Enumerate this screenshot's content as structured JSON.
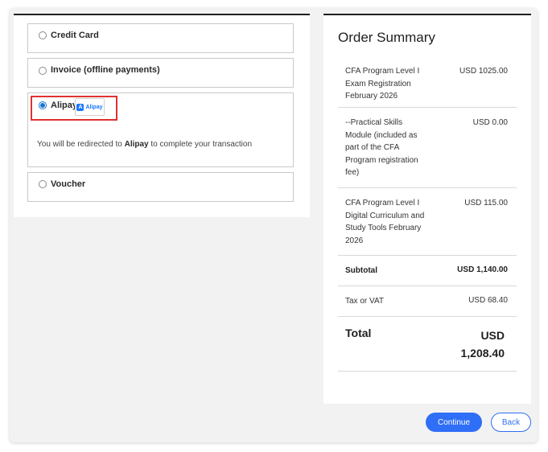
{
  "payment": {
    "options": [
      {
        "label": "Credit Card",
        "selected": false
      },
      {
        "label": "Invoice (offline payments)",
        "selected": false
      },
      {
        "label": "Alipay",
        "selected": true
      },
      {
        "label": "Voucher",
        "selected": false
      }
    ],
    "alipay_logo_text": "Alipay",
    "alipay_logo_mark": "A",
    "redirect_prefix": "You will be redirected to ",
    "redirect_bold": "Alipay",
    "redirect_suffix": " to complete your transaction",
    "highlight_color": "#e03131"
  },
  "summary": {
    "title": "Order Summary",
    "items": [
      {
        "desc_lines": [
          "CFA Program Level I",
          "Exam Registration",
          "February 2026"
        ],
        "amount": "USD 1025.00"
      },
      {
        "desc_lines": [
          "--Practical Skills",
          "Module (included as",
          "part of the CFA",
          "Program registration",
          "fee)"
        ],
        "amount": "USD 0.00"
      },
      {
        "desc_lines": [
          "CFA Program Level I",
          "Digital Curriculum and",
          "Study Tools February",
          "2026"
        ],
        "amount": "USD 115.00"
      }
    ],
    "subtotal_label": "Subtotal",
    "subtotal_amount": "USD 1,140.00",
    "tax_label": "Tax or VAT",
    "tax_amount": "USD 68.40",
    "total_label": "Total",
    "total_currency": "USD",
    "total_amount": "1,208.40"
  },
  "actions": {
    "continue_label": "Continue",
    "back_label": "Back",
    "accent_color": "#2f6ef6"
  }
}
